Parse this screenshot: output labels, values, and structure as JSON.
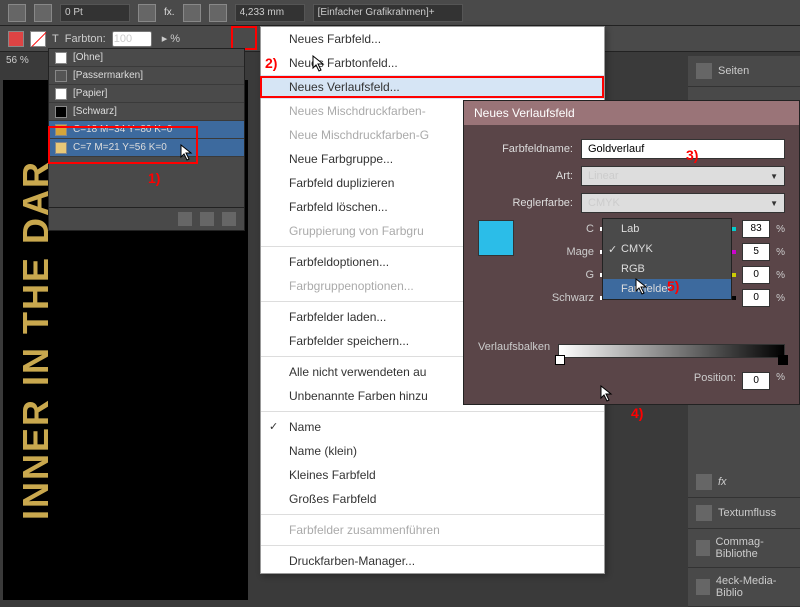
{
  "toolbar": {
    "pt": "0 Pt",
    "mm": "4,233 mm",
    "frame": "[Einfacher Grafikrahmen]+"
  },
  "toolbar2": {
    "farbton_lbl": "Farbton:",
    "farbton_val": "100"
  },
  "zoom": "56 %",
  "swatches": {
    "rows": [
      {
        "name": "[Ohne]",
        "chip": "#fff"
      },
      {
        "name": "[Passermarken]",
        "chip": "#555"
      },
      {
        "name": "[Papier]",
        "chip": "#fff"
      },
      {
        "name": "[Schwarz]",
        "chip": "#000"
      },
      {
        "name": "C=18 M=34 Y=80 K=0",
        "chip": "#d4a53a"
      },
      {
        "name": "C=7 M=21 Y=56 K=0",
        "chip": "#e8c878"
      }
    ]
  },
  "menu": {
    "items": [
      {
        "t": "Neues Farbfeld...",
        "d": false
      },
      {
        "t": "Neues Farbtonfeld...",
        "d": false
      },
      {
        "t": "Neues Verlaufsfeld...",
        "d": false,
        "hov": true
      },
      {
        "t": "Neues Mischdruckfarben-",
        "d": true
      },
      {
        "t": "Neue Mischdruckfarben-G",
        "d": true
      },
      {
        "t": "Neue Farbgruppe...",
        "d": false
      },
      {
        "t": "Farbfeld duplizieren",
        "d": false
      },
      {
        "t": "Farbfeld löschen...",
        "d": false
      },
      {
        "t": "Gruppierung von Farbgru",
        "d": true
      },
      "-",
      {
        "t": "Farbfeldoptionen...",
        "d": false
      },
      {
        "t": "Farbgruppenoptionen...",
        "d": true
      },
      "-",
      {
        "t": "Farbfelder laden...",
        "d": false
      },
      {
        "t": "Farbfelder speichern...",
        "d": false
      },
      "-",
      {
        "t": "Alle nicht verwendeten au",
        "d": false
      },
      {
        "t": "Unbenannte Farben hinzu",
        "d": false
      },
      "-",
      {
        "t": "Name",
        "d": false,
        "chk": true
      },
      {
        "t": "Name (klein)",
        "d": false
      },
      {
        "t": "Kleines Farbfeld",
        "d": false
      },
      {
        "t": "Großes Farbfeld",
        "d": false
      },
      "-",
      {
        "t": "Farbfelder zusammenführen",
        "d": true
      },
      "-",
      {
        "t": "Druckfarben-Manager...",
        "d": false
      }
    ]
  },
  "dialog": {
    "title": "Neues Verlaufsfeld",
    "name_lbl": "Farbfeldname:",
    "name_val": "Goldverlauf",
    "art_lbl": "Art:",
    "art_val": "Linear",
    "regler_lbl": "Reglerfarbe:",
    "regler_val": "CMYK",
    "cyan": "C",
    "cyan_v": "83",
    "mag": "Mage",
    "mag_v": "5",
    "gel": "G",
    "gel_v": "0",
    "schw": "Schwarz",
    "schw_v": "0",
    "verlauf": "Verlaufsbalken",
    "pos_lbl": "Position:",
    "pos_v": "0",
    "pct": "%"
  },
  "dropdown": {
    "items": [
      "Lab",
      "CMYK",
      "RGB",
      "Farbfelder"
    ]
  },
  "canvas_text": "INNER IN THE DAR",
  "right": {
    "seiten": "Seiten",
    "textumfluss": "Textumfluss",
    "commag": "Commag-Bibliothe",
    "eck": "4eck-Media-Biblio"
  },
  "ann": {
    "a1": "1)",
    "a2": "2)",
    "a3": "3)",
    "a4": "4)",
    "a5": "5)"
  }
}
